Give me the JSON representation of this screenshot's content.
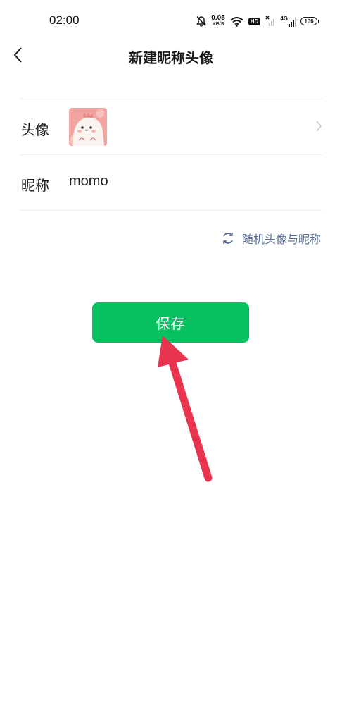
{
  "status_bar": {
    "time": "02:00",
    "net_speed": "0.05",
    "net_speed_unit": "KB/S",
    "hd_label": "HD",
    "network_label": "4G",
    "battery": "100"
  },
  "header": {
    "title": "新建昵称头像"
  },
  "avatar_row": {
    "label": "头像"
  },
  "nickname_row": {
    "label": "昵称",
    "value": "momo"
  },
  "random_link": {
    "label": "随机头像与昵称"
  },
  "save_button": {
    "label": "保存"
  },
  "colors": {
    "primary_green": "#07c160",
    "link_blue": "#576b95",
    "arrow_red": "#e8344e"
  }
}
